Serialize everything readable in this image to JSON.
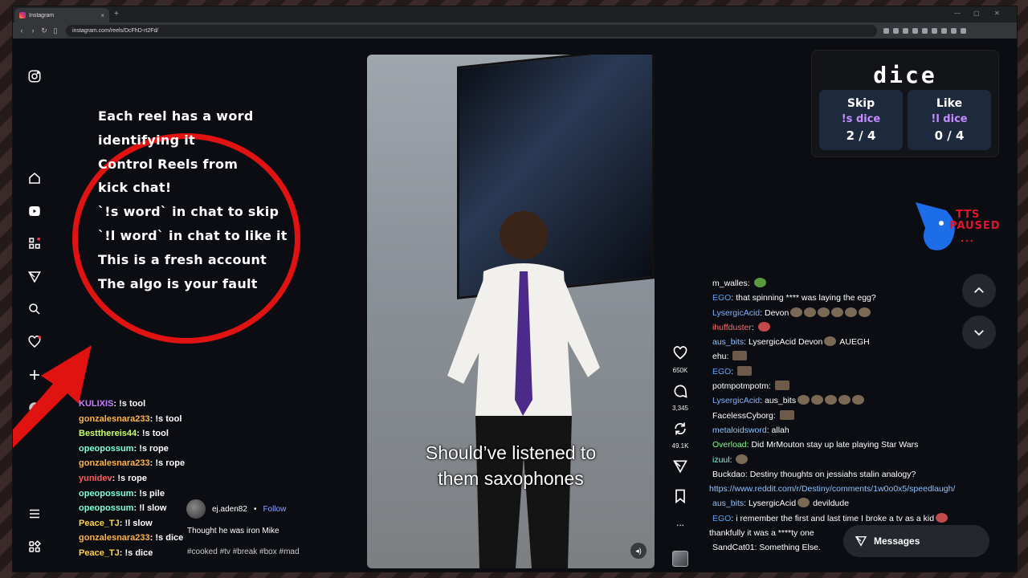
{
  "browser": {
    "tab_title": "Instagram",
    "tab_close": "×",
    "new_tab": "+",
    "url": "instagram.com/reels/DcFhD-rt2Fd/",
    "win_min": "—",
    "win_max": "▢",
    "win_close": "✕"
  },
  "overlay": {
    "lines": [
      "Each reel has a word",
      "identifying it",
      "Control Reels from",
      "kick chat!",
      "`!s word` in chat to skip",
      "`!l word` in chat to like it",
      "This is a fresh account",
      "The algo is your fault"
    ]
  },
  "left_chat": [
    {
      "user": "KULIXIS",
      "color": "#c77dff",
      "msg": "!s tool"
    },
    {
      "user": "gonzalesnara233",
      "color": "#ffb347",
      "msg": "!s tool"
    },
    {
      "user": "Bestthereis44",
      "color": "#c6ff6b",
      "msg": "!s tool"
    },
    {
      "user": "opeopossum",
      "color": "#7fffd4",
      "msg": "!s rope"
    },
    {
      "user": "gonzalesnara233",
      "color": "#ffb347",
      "msg": "!s rope"
    },
    {
      "user": "yunidev",
      "color": "#ff5d5d",
      "msg": "!s rope"
    },
    {
      "user": "opeopossum",
      "color": "#7fffd4",
      "msg": "!s pile"
    },
    {
      "user": "opeopossum",
      "color": "#7fffd4",
      "msg": "!l slow"
    },
    {
      "user": "Peace_TJ",
      "color": "#ffd24d",
      "msg": "!l slow"
    },
    {
      "user": "gonzalesnara233",
      "color": "#ffb347",
      "msg": "!s dice"
    },
    {
      "user": "Peace_TJ",
      "color": "#ffd24d",
      "msg": "!s dice"
    }
  ],
  "reel": {
    "caption_line1": "Should’ve listened to",
    "caption_line2": "them saxophones",
    "author": "ej.aden82",
    "dot": "•",
    "follow": "Follow",
    "description": "Thought he was iron Mike",
    "tags": "#cooked #tv #break #box #mad",
    "mute_icon": "◂)"
  },
  "actions": {
    "likes": "650K",
    "comments": "3,345",
    "reposts": "49.1K",
    "more": "..."
  },
  "dice": {
    "word": "dice",
    "skip_label": "Skip",
    "skip_cmd": "!s dice",
    "skip_count": "2 / 4",
    "like_label": "Like",
    "like_cmd": "!l dice",
    "like_count": "0 / 4"
  },
  "tts": {
    "word1": "TTS",
    "word2": "PAUSED",
    "dots": "..."
  },
  "right_chat": [
    {
      "user": "m_walles",
      "color": "#ffffff",
      "msg": "",
      "emotes": [
        "g"
      ]
    },
    {
      "user": "EGO",
      "color": "#58a6ff",
      "msg": "that spinning **** was laying the egg?",
      "emotes": []
    },
    {
      "user": "LysergicAcid",
      "color": "#7fb0ff",
      "msg": "Devon",
      "emotes": [
        "n",
        "n",
        "n",
        "n",
        "n",
        "n"
      ]
    },
    {
      "user": "ihuffduster",
      "color": "#ff6b6b",
      "msg": "",
      "emotes": [
        "r"
      ]
    },
    {
      "user": "aus_bits",
      "color": "#8fc1ff",
      "msg": "LysergicAcid Devon",
      "emotes": [
        "n"
      ],
      "after": "AUEGH"
    },
    {
      "user": "ehu",
      "color": "#ffffff",
      "msg": "",
      "emotes": [
        "d"
      ]
    },
    {
      "user": "EGO",
      "color": "#58a6ff",
      "msg": "",
      "emotes": [
        "d"
      ]
    },
    {
      "user": "potmpotmpotm",
      "color": "#ffffff",
      "msg": "",
      "emotes": [
        "d"
      ]
    },
    {
      "user": "LysergicAcid",
      "color": "#7fb0ff",
      "msg": "aus_bits",
      "emotes": [
        "n",
        "n",
        "n",
        "n",
        "n"
      ]
    },
    {
      "user": "FacelessCyborg",
      "color": "#ffffff",
      "msg": "",
      "emotes": [
        "d"
      ]
    },
    {
      "user": "metaloidsword",
      "color": "#8fc1ff",
      "msg": "allah",
      "emotes": []
    },
    {
      "user": "Overload",
      "color": "#7cfc8a",
      "msg": "Did MrMouton stay up late playing Star Wars",
      "emotes": []
    },
    {
      "user": "izuul",
      "color": "#7cffd9",
      "msg": "",
      "emotes": [
        "n"
      ]
    },
    {
      "user": "Buckdao",
      "color": "#ffffff",
      "msg": "Destiny thoughts on jessiahs stalin analogy?",
      "emotes": []
    },
    {
      "user": "",
      "color": "#8fc1ff",
      "msg": "https://www.reddit.com/r/Destiny/comments/1w0o0x5/speedlaugh/",
      "emotes": [],
      "link": true
    },
    {
      "user": "aus_bits",
      "color": "#8fc1ff",
      "msg": "LysergicAcid",
      "emotes": [
        "n"
      ],
      "after": "devildude"
    },
    {
      "user": "EGO",
      "color": "#58a6ff",
      "msg": "i remember the first and last time I broke a tv as a kid",
      "emotes": [
        "r"
      ]
    },
    {
      "user": "",
      "color": "#ffffff",
      "msg": "thankfully it was a ****ty one",
      "emotes": [],
      "plain": true
    },
    {
      "user": "SandCat01",
      "color": "#ffffff",
      "msg": "Something Else.",
      "emotes": []
    }
  ],
  "messages_label": "Messages"
}
